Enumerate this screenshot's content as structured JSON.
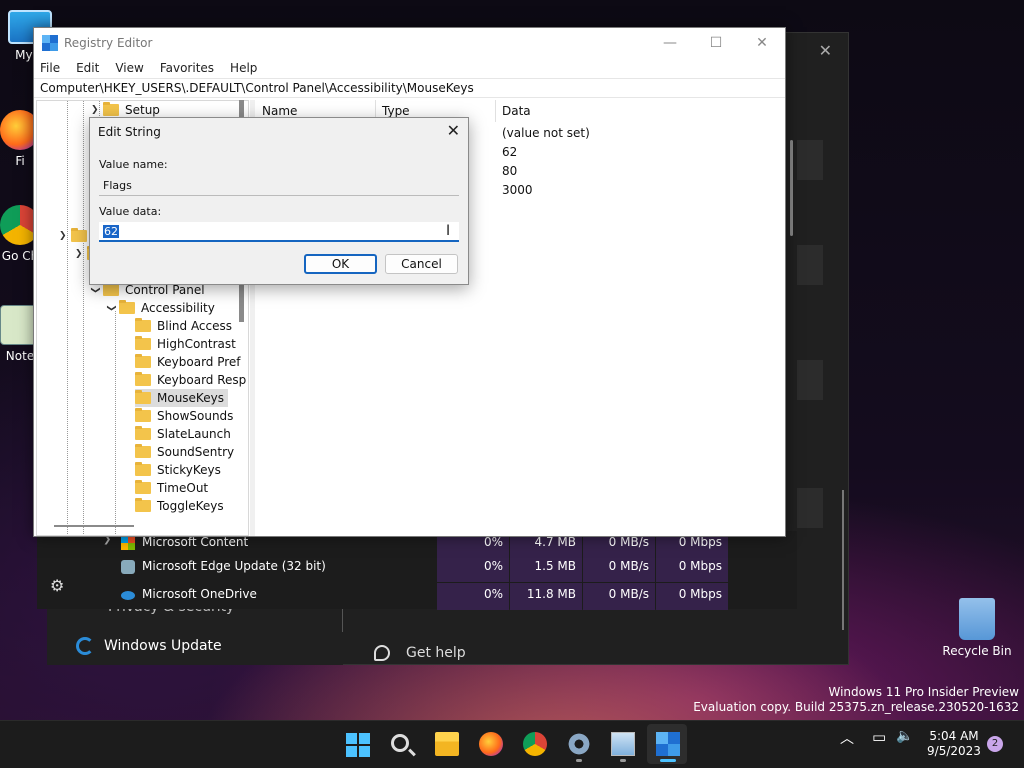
{
  "desktop": {
    "icons": [
      {
        "label": "My C"
      },
      {
        "label": "Fi"
      },
      {
        "label": "Go Ch"
      },
      {
        "label": "Note"
      }
    ],
    "recycle_bin": "Recycle Bin",
    "watermark_line1": "Windows 11 Pro Insider Preview",
    "watermark_line2": "Evaluation copy. Build 25375.zn_release.230520-1632"
  },
  "settings_bg": {
    "privacy": "Privacy & security",
    "windows_update": "Windows Update",
    "get_help": "Get help"
  },
  "task_manager_bg": {
    "rows": [
      {
        "name": "Microsoft Content",
        "cpu": "0%",
        "mem": "4.7 MB",
        "disk": "0 MB/s",
        "net": "0 Mbps"
      },
      {
        "name": "Microsoft Edge Update (32 bit)",
        "cpu": "0%",
        "mem": "1.5 MB",
        "disk": "0 MB/s",
        "net": "0 Mbps"
      },
      {
        "name": "Microsoft OneDrive",
        "cpu": "0%",
        "mem": "11.8 MB",
        "disk": "0 MB/s",
        "net": "0 Mbps"
      }
    ]
  },
  "registry": {
    "title": "Registry Editor",
    "menu": [
      "File",
      "Edit",
      "View",
      "Favorites",
      "Help"
    ],
    "address": "Computer\\HKEY_USERS\\.DEFAULT\\Control Panel\\Accessibility\\MouseKeys",
    "tree": {
      "setup": "Setup",
      "control_panel": "Control Panel",
      "accessibility": "Accessibility",
      "children": [
        "Blind Access",
        "HighContrast",
        "Keyboard Pref",
        "Keyboard Resp",
        "MouseKeys",
        "ShowSounds",
        "SlateLaunch",
        "SoundSentry",
        "StickyKeys",
        "TimeOut",
        "ToggleKeys"
      ],
      "selected": "MouseKeys"
    },
    "columns": {
      "name": "Name",
      "type": "Type",
      "data": "Data"
    },
    "data_values": [
      "(value not set)",
      "62",
      "80",
      "3000"
    ]
  },
  "dialog": {
    "title": "Edit String",
    "value_name_label": "Value name:",
    "value_name": "Flags",
    "value_data_label": "Value data:",
    "value_data": "62",
    "ok": "OK",
    "cancel": "Cancel"
  },
  "taskbar": {
    "time": "5:04 AM",
    "date": "9/5/2023",
    "notification_count": "2"
  }
}
